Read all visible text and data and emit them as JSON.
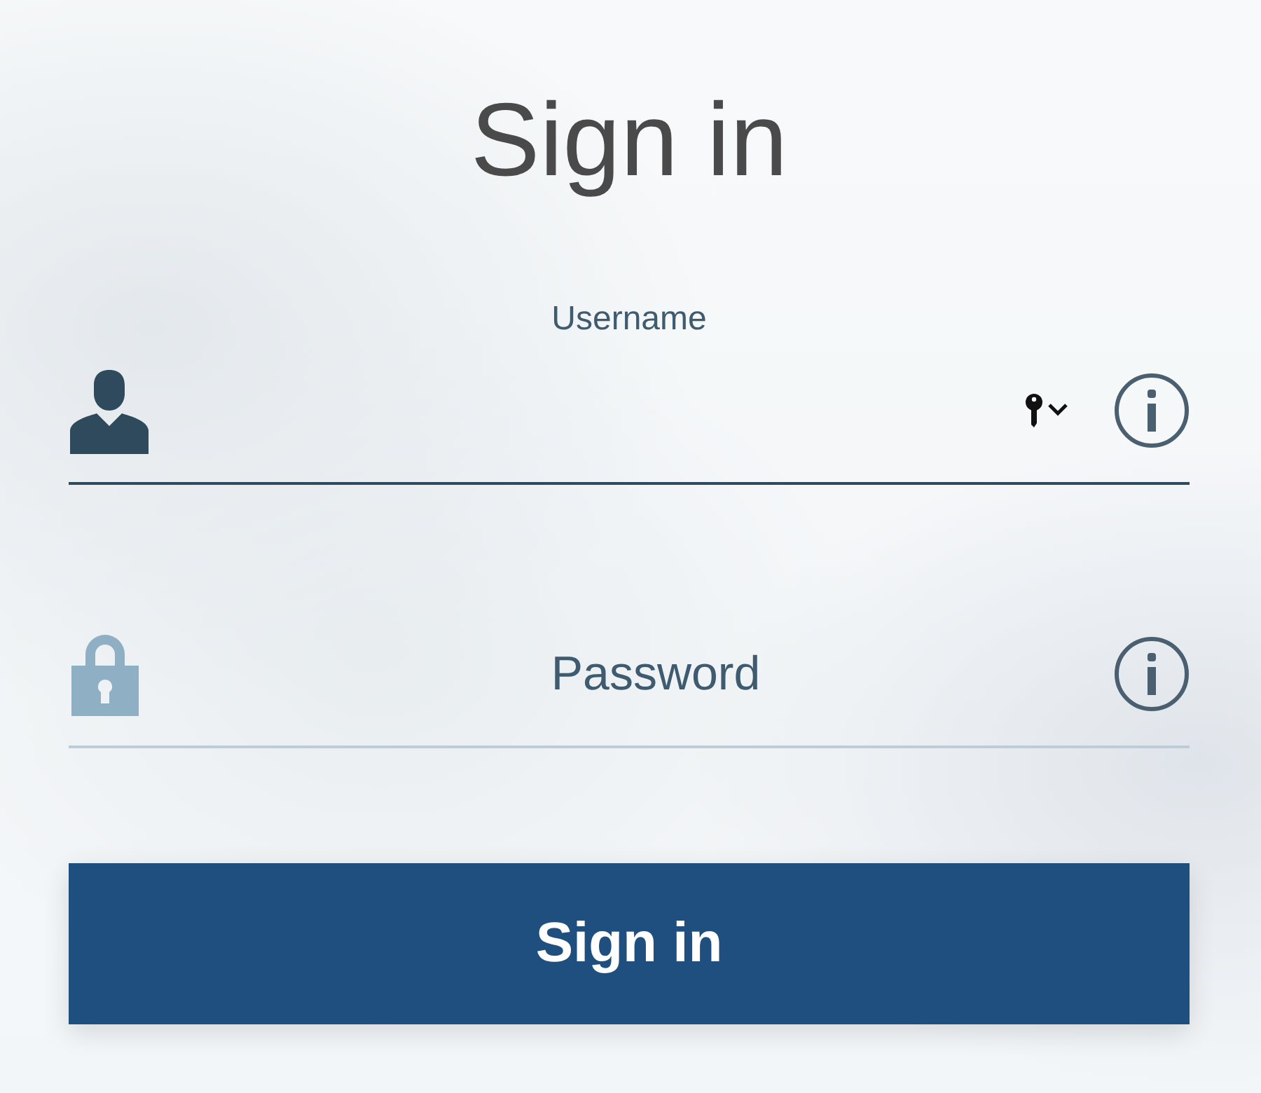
{
  "title": "Sign in",
  "fields": [
    {
      "kind": "username",
      "label": "Username",
      "focused": true,
      "key_menu": true
    },
    {
      "kind": "password",
      "placeholder": "Password",
      "focused": false,
      "key_menu": false
    }
  ],
  "submit": {
    "label": "Sign in"
  }
}
